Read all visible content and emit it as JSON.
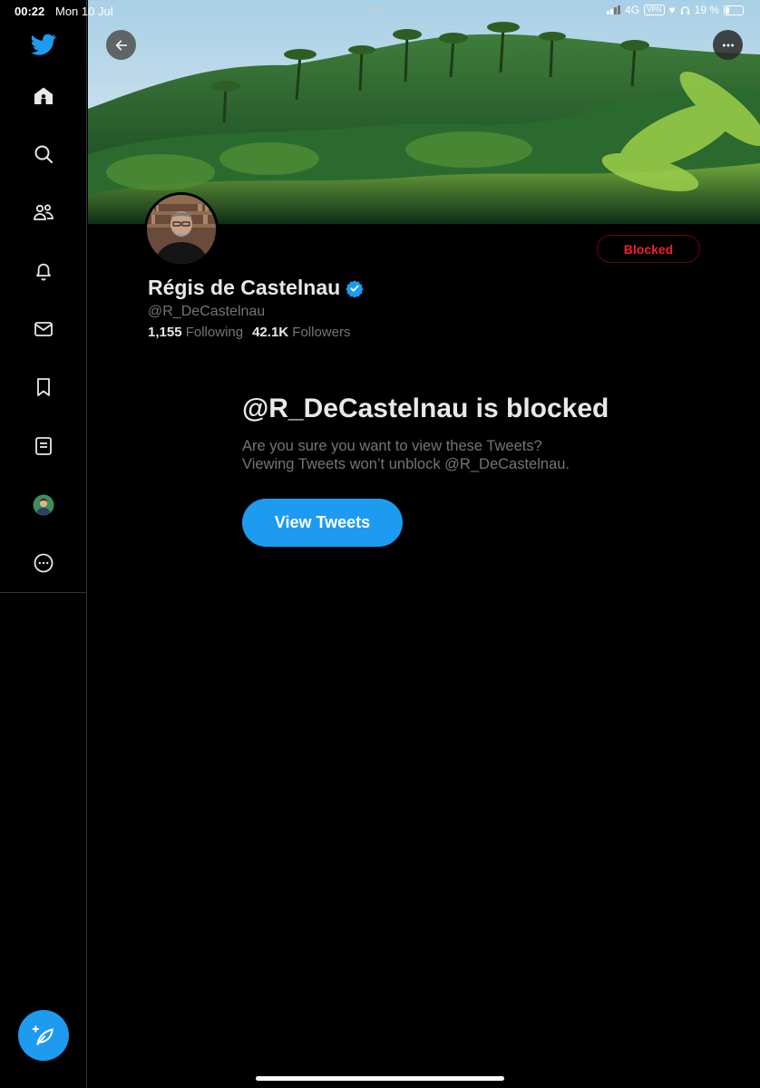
{
  "status_bar": {
    "time": "00:22",
    "date": "Mon 10 Jul",
    "dots": "•••",
    "network": "4G",
    "vpn": "VPN",
    "battery": "19 %"
  },
  "sidebar": {
    "items": [
      {
        "name": "home-icon"
      },
      {
        "name": "search-icon"
      },
      {
        "name": "communities-icon"
      },
      {
        "name": "notifications-icon"
      },
      {
        "name": "messages-icon"
      },
      {
        "name": "bookmarks-icon"
      },
      {
        "name": "lists-icon"
      },
      {
        "name": "profile-avatar-icon"
      },
      {
        "name": "more-icon"
      }
    ],
    "compose_icon": "compose-icon"
  },
  "profile": {
    "display_name": "Régis de Castelnau",
    "handle": "@R_DeCastelnau",
    "following_count": "1,155",
    "following_label": "Following",
    "followers_count": "42.1K",
    "followers_label": "Followers",
    "blocked_label": "Blocked",
    "verified": true
  },
  "blocked_notice": {
    "title": "@R_DeCastelnau is blocked",
    "line1": "Are you sure you want to view these Tweets?",
    "line2": "Viewing Tweets won’t unblock @R_DeCastelnau.",
    "button_label": "View Tweets"
  },
  "colors": {
    "accent": "#1d9bf0",
    "danger": "#f4212e",
    "background": "#000000",
    "muted_text": "#71767b"
  }
}
